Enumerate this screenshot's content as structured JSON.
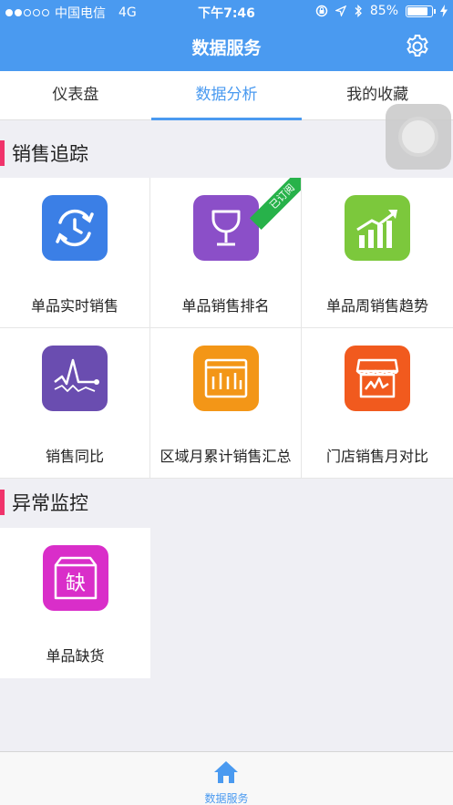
{
  "status_bar": {
    "carrier": "中国电信",
    "network": "4G",
    "time": "下午7:46",
    "battery": "85%",
    "battery_level": 0.85
  },
  "nav": {
    "title": "数据服务",
    "settings_icon": "gear-icon"
  },
  "tabs": [
    {
      "label": "仪表盘",
      "active": false
    },
    {
      "label": "数据分析",
      "active": true
    },
    {
      "label": "我的收藏",
      "active": false
    }
  ],
  "sections": [
    {
      "title": "销售追踪",
      "items": [
        {
          "label": "单品实时销售",
          "icon": "clock-refresh-icon",
          "color": "#3b7fe6"
        },
        {
          "label": "单品销售排名",
          "icon": "trophy-icon",
          "color": "#8b4fc8",
          "badge": "已订阅"
        },
        {
          "label": "单品周销售趋势",
          "icon": "bar-trend-icon",
          "color": "#7cc83c"
        },
        {
          "label": "销售同比",
          "icon": "line-compare-icon",
          "color": "#6a4db0"
        },
        {
          "label": "区域月累计销售汇总",
          "icon": "column-chart-icon",
          "color": "#f39617"
        },
        {
          "label": "门店销售月对比",
          "icon": "store-icon",
          "color": "#f15a1e"
        }
      ]
    },
    {
      "title": "异常监控",
      "items": [
        {
          "label": "单品缺货",
          "icon": "out-of-stock-icon",
          "color": "#d92ec9",
          "glyph": "缺"
        }
      ]
    }
  ],
  "bottom_tab": {
    "label": "数据服务",
    "icon": "home-icon",
    "color": "#4a9af0"
  },
  "colors": {
    "primary": "#4a9af0",
    "section_accent": "#f0336b",
    "ribbon": "#27b24a"
  }
}
